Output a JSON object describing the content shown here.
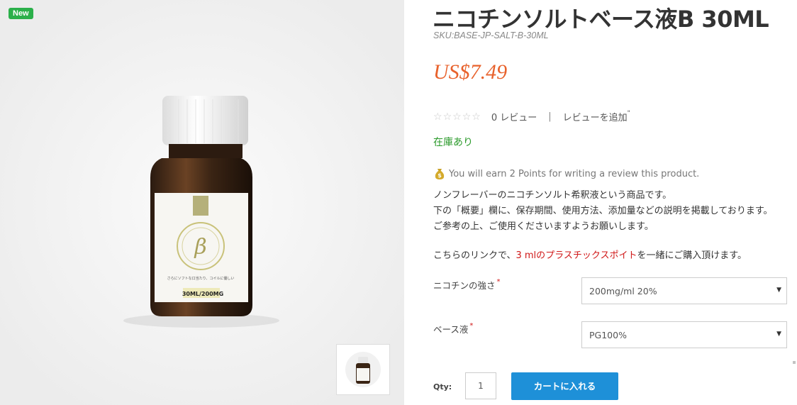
{
  "gallery": {
    "badge": "New",
    "bottle_label": {
      "brand_ring_text": "DO IT YOURSELF",
      "tagline": "さらにソフトな口当たり、コイルに優しい",
      "volume": "30ML/200MG"
    }
  },
  "product": {
    "title": "ニコチンソルトベース液B 30ML",
    "sku": "SKU:BASE-JP-SALT-B-30ML",
    "price": "US$7.49",
    "rating": {
      "stars_filled": 0,
      "stars_total": 5,
      "review_count": "0 レビュー",
      "separator": "|",
      "add_review": "レビューを追加"
    },
    "stock": "在庫あり",
    "points_note": "You will earn 2 Points for writing a review this product.",
    "description": [
      "ノンフレーバーのニコチンソルト希釈液という商品です。",
      "下の「概要」欄に、保存期間、使用方法、添加量などの説明を掲載しております。",
      "ご参考の上、ご使用くださいますようお願いします。"
    ],
    "link_line": {
      "prefix": "こちらのリンクで、",
      "link": "3 mlのプラスチックスポイト",
      "suffix": "を一緒にご購入頂けます。"
    }
  },
  "options": {
    "nicotine": {
      "label": "ニコチンの強さ",
      "required": "*",
      "value": "200mg/ml 20%"
    },
    "base": {
      "label": "ベース液",
      "required": "*",
      "value": "PG100%"
    }
  },
  "purchase": {
    "qty_label": "Qty:",
    "qty_value": "1",
    "cart_button": "カートに入れる"
  },
  "colors": {
    "price": "#e8622c",
    "stock": "#2b9a2b",
    "button": "#1e90d8",
    "badge": "#2bb04a",
    "link": "#d01818"
  }
}
